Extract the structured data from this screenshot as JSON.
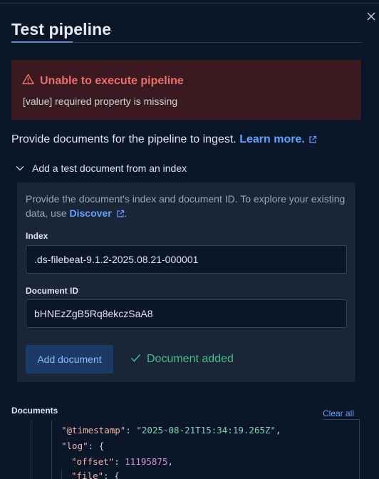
{
  "flyout": {
    "title": "Test pipeline",
    "close_icon": "close-icon"
  },
  "error_callout": {
    "icon": "warning-icon",
    "title": "Unable to execute pipeline",
    "message": "[value] required property is missing",
    "color": "#ee6e6e"
  },
  "intro": {
    "text": "Provide documents for the pipeline to ingest.",
    "link_label": "Learn more."
  },
  "accordion": {
    "label": "Add a test document from an index",
    "expanded": true
  },
  "add_document_panel": {
    "help_text": "Provide the document's index and document ID. To explore your existing data, use",
    "help_link": "Discover",
    "help_suffix": ".",
    "index_label": "Index",
    "index_value": ".ds-filebeat-9.1.2-2025.08.21-000001",
    "document_id_label": "Document ID",
    "document_id_value": "bHNEzZgB5Rq8ekczSaA8",
    "add_button_label": "Add document",
    "status_text": "Document added",
    "status_color": "#3fbf8a"
  },
  "documents": {
    "label": "Documents",
    "clear_label": "Clear all",
    "code_lines": [
      {
        "key": "\"@timestamp\"",
        "value": "\"2025-08-21T15:34:19.265Z\"",
        "suffix": ","
      },
      {
        "key": "\"log\"",
        "value": "{",
        "suffix": ""
      },
      {
        "key": "\"offset\"",
        "value": "11195875",
        "suffix": ","
      },
      {
        "key": "\"file\"",
        "value": "{",
        "suffix": ""
      }
    ]
  }
}
